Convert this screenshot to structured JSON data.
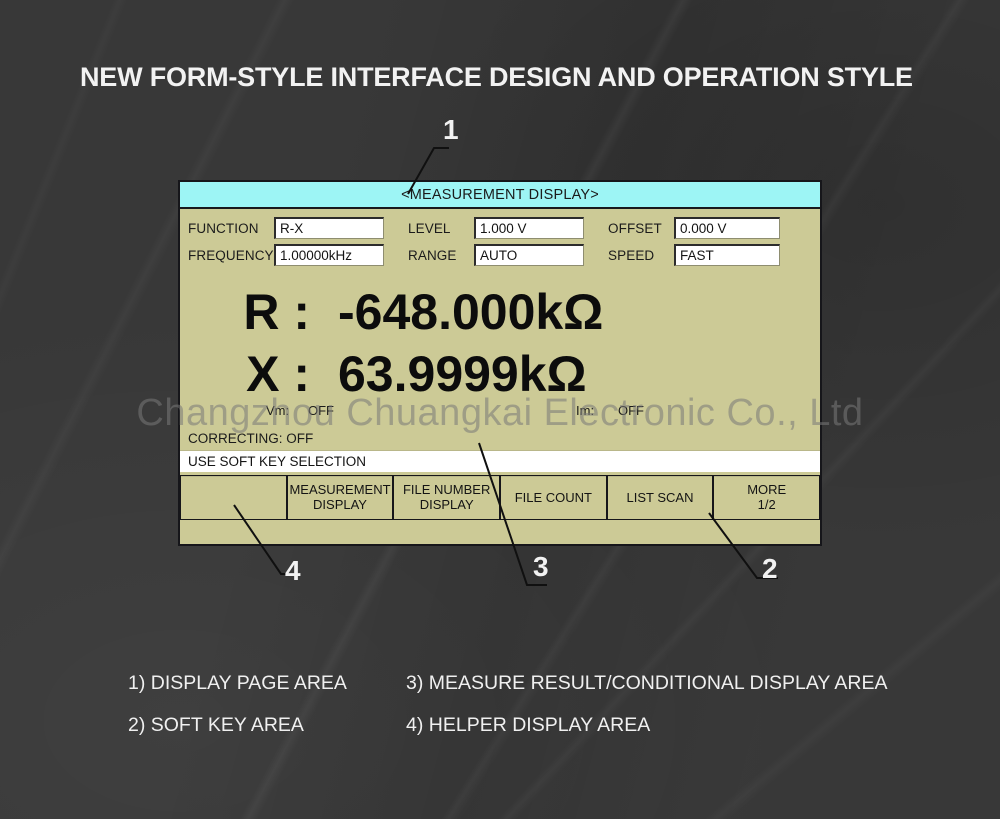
{
  "headline": "NEW FORM-STYLE INTERFACE DESIGN AND OPERATION STYLE",
  "watermark": "Changzhou Chuangkai Electronic Co., Ltd",
  "colors": {
    "background": "#383838",
    "screen_body": "#ccca96",
    "header_bar": "#9df5f5",
    "field_bg": "#ffffff",
    "text": "#141414",
    "callout": "#f2f2f2"
  },
  "screen": {
    "header_title": "<MEASUREMENT DISPLAY>",
    "parameters": [
      {
        "label": "FUNCTION",
        "value": "R-X"
      },
      {
        "label": "LEVEL",
        "value": "1.000 V"
      },
      {
        "label": "OFFSET",
        "value": "0.000 V"
      },
      {
        "label": "FREQUENCY",
        "value": "1.00000kHz"
      },
      {
        "label": "RANGE",
        "value": "AUTO"
      },
      {
        "label": "SPEED",
        "value": "FAST"
      }
    ],
    "readout": [
      {
        "symbol": "R :",
        "value": "-648.000kΩ"
      },
      {
        "symbol": "X :",
        "value": "63.9999kΩ"
      }
    ],
    "monitor": [
      {
        "label": "Vm:",
        "value": "OFF"
      },
      {
        "label": "Im:",
        "value": "OFF"
      }
    ],
    "status_line": "CORRECTING:  OFF",
    "helper_line": "USE SOFT KEY SELECTION",
    "softkeys": [
      {
        "line1": "",
        "line2": ""
      },
      {
        "line1": "MEASUREMENT",
        "line2": "DISPLAY"
      },
      {
        "line1": "FILE NUMBER",
        "line2": "DISPLAY"
      },
      {
        "line1": "FILE COUNT",
        "line2": ""
      },
      {
        "line1": "LIST SCAN",
        "line2": ""
      },
      {
        "line1": "MORE",
        "line2": "1/2"
      }
    ]
  },
  "callouts": [
    {
      "id": "1",
      "label": "1"
    },
    {
      "id": "2",
      "label": "2"
    },
    {
      "id": "3",
      "label": "3"
    },
    {
      "id": "4",
      "label": "4"
    }
  ],
  "legend": [
    {
      "left": "1) DISPLAY PAGE AREA",
      "right": "3) MEASURE RESULT/CONDITIONAL DISPLAY AREA"
    },
    {
      "left": "2) SOFT KEY AREA",
      "right": "4) HELPER DISPLAY AREA"
    }
  ]
}
